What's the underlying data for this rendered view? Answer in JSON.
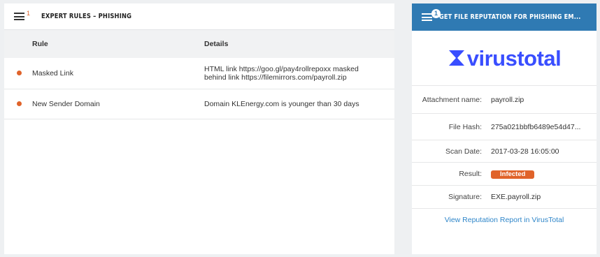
{
  "left": {
    "count": "1",
    "title": "EXPERT RULES – PHISHING",
    "columns": {
      "rule": "Rule",
      "details": "Details"
    },
    "rows": [
      {
        "rule": "Masked Link",
        "details": "HTML link https://goo.gl/pay4rollrepoxx masked behind link https://filemirrors.com/payroll.zip"
      },
      {
        "rule": "New Sender Domain",
        "details": "Domain KLEnergy.com is younger than 30 days"
      }
    ]
  },
  "right": {
    "badge": "1",
    "title": "GET FILE REPUTATION FOR PHISHING EM...",
    "logo_text": "virustotal",
    "fields": {
      "attachment_label": "Attachment name:",
      "attachment_value": "payroll.zip",
      "hash_label": "File Hash:",
      "hash_value": "275a021bbfb6489e54d47...",
      "scan_label": "Scan Date:",
      "scan_value": "2017-03-28 16:05:00",
      "result_label": "Result:",
      "result_value": "Infected",
      "signature_label": "Signature:",
      "signature_value": "EXE.payroll.zip"
    },
    "link": "View Reputation Report in VirusTotal"
  },
  "colors": {
    "accent_orange": "#e0632a",
    "header_blue": "#2f7ab3",
    "virustotal_blue": "#394eff",
    "link_blue": "#2f86c9"
  }
}
